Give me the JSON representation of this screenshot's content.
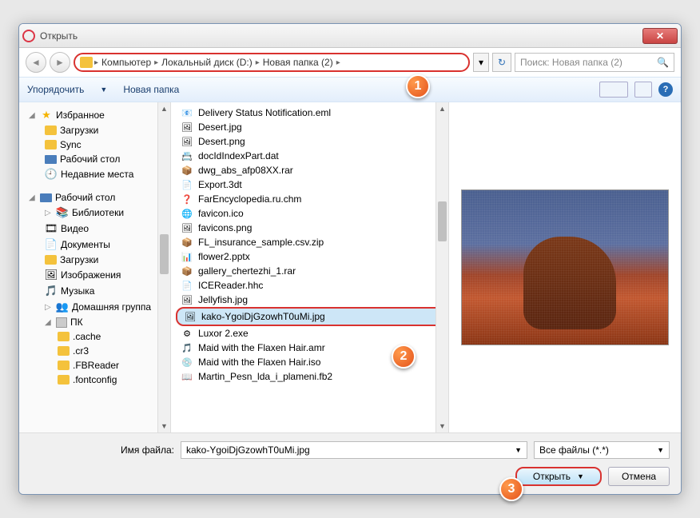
{
  "title": "Открыть",
  "breadcrumb": {
    "root": "Компьютер",
    "drive": "Локальный диск (D:)",
    "folder": "Новая папка (2)"
  },
  "search_placeholder": "Поиск: Новая папка (2)",
  "toolbar": {
    "organize": "Упорядочить",
    "newfolder": "Новая папка"
  },
  "sidebar": {
    "favorites": "Избранное",
    "downloads": "Загрузки",
    "sync": "Sync",
    "desktop": "Рабочий стол",
    "recent": "Недавние места",
    "desktop2": "Рабочий стол",
    "libraries": "Библиотеки",
    "video": "Видео",
    "documents": "Документы",
    "downloads2": "Загрузки",
    "images": "Изображения",
    "music": "Музыка",
    "homegroup": "Домашняя группа",
    "pc": "ПК",
    "cache": ".cache",
    "cr3": ".cr3",
    "fbreader": ".FBReader",
    "fontconfig": ".fontconfig"
  },
  "files": [
    {
      "name": "Delivery Status Notification.eml",
      "icon": "📧"
    },
    {
      "name": "Desert.jpg",
      "icon": "🖼"
    },
    {
      "name": "Desert.png",
      "icon": "🖼"
    },
    {
      "name": "docIdIndexPart.dat",
      "icon": "📇"
    },
    {
      "name": "dwg_abs_afp08XX.rar",
      "icon": "📦"
    },
    {
      "name": "Export.3dt",
      "icon": "📄"
    },
    {
      "name": "FarEncyclopedia.ru.chm",
      "icon": "❓"
    },
    {
      "name": "favicon.ico",
      "icon": "🌐"
    },
    {
      "name": "favicons.png",
      "icon": "🖼"
    },
    {
      "name": "FL_insurance_sample.csv.zip",
      "icon": "📦"
    },
    {
      "name": "flower2.pptx",
      "icon": "📊"
    },
    {
      "name": "gallery_chertezhi_1.rar",
      "icon": "📦"
    },
    {
      "name": "ICEReader.hhc",
      "icon": "📄"
    },
    {
      "name": "Jellyfish.jpg",
      "icon": "🖼"
    },
    {
      "name": "kako-YgoiDjGzowhT0uMi.jpg",
      "icon": "🖼"
    },
    {
      "name": "Luxor 2.exe",
      "icon": "⚙"
    },
    {
      "name": "Maid with the Flaxen Hair.amr",
      "icon": "🎵"
    },
    {
      "name": "Maid with the Flaxen Hair.iso",
      "icon": "💿"
    },
    {
      "name": "Martin_Pesn_lda_i_plameni.fb2",
      "icon": "📖"
    }
  ],
  "selected_index": 14,
  "filename_label": "Имя файла:",
  "filename_value": "kako-YgoiDjGzowhT0uMi.jpg",
  "filter_value": "Все файлы (*.*)",
  "open_label": "Открыть",
  "cancel_label": "Отмена",
  "callouts": {
    "c1": "1",
    "c2": "2",
    "c3": "3"
  }
}
